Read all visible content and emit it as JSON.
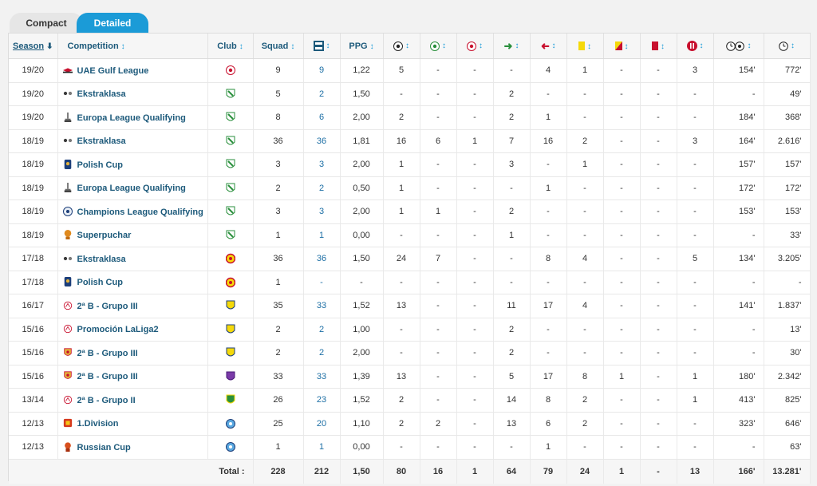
{
  "tabs": [
    {
      "label": "Compact",
      "active": false
    },
    {
      "label": "Detailed",
      "active": true
    }
  ],
  "headers": {
    "season": "Season",
    "competition": "Competition",
    "club": "Club",
    "squad": "Squad",
    "ppg": "PPG"
  },
  "header_icons": [
    "appearances-icon",
    "goals-icon",
    "assists-icon",
    "own-goals-icon",
    "substituted-on-icon",
    "substituted-off-icon",
    "yellow-card-icon",
    "second-yellow-card-icon",
    "red-card-icon",
    "penalty-goals-icon",
    "minutes-per-goal-icon",
    "minutes-played-icon"
  ],
  "rows": [
    {
      "season": "19/20",
      "competition": "UAE Gulf League",
      "comp_icon": "gulf-league-icon",
      "club_icon": "club-crest-icon",
      "squad": "9",
      "apps": "9",
      "ppg": "1,22",
      "goals": "5",
      "assists": "-",
      "own_goals": "-",
      "sub_on": "-",
      "sub_off": "4",
      "yellow": "1",
      "second_yellow": "-",
      "red": "-",
      "penalty": "3",
      "min_per_goal": "154'",
      "minutes": "772'"
    },
    {
      "season": "19/20",
      "competition": "Ekstraklasa",
      "comp_icon": "ekstraklasa-icon",
      "club_icon": "legia-crest-icon",
      "squad": "5",
      "apps": "2",
      "ppg": "1,50",
      "goals": "-",
      "assists": "-",
      "own_goals": "-",
      "sub_on": "2",
      "sub_off": "-",
      "yellow": "-",
      "second_yellow": "-",
      "red": "-",
      "penalty": "-",
      "min_per_goal": "-",
      "minutes": "49'"
    },
    {
      "season": "19/20",
      "competition": "Europa League Qualifying",
      "comp_icon": "europa-league-icon",
      "club_icon": "legia-crest-icon",
      "squad": "8",
      "apps": "6",
      "ppg": "2,00",
      "goals": "2",
      "assists": "-",
      "own_goals": "-",
      "sub_on": "2",
      "sub_off": "1",
      "yellow": "-",
      "second_yellow": "-",
      "red": "-",
      "penalty": "-",
      "min_per_goal": "184'",
      "minutes": "368'"
    },
    {
      "season": "18/19",
      "competition": "Ekstraklasa",
      "comp_icon": "ekstraklasa-icon",
      "club_icon": "legia-crest-icon",
      "squad": "36",
      "apps": "36",
      "ppg": "1,81",
      "goals": "16",
      "assists": "6",
      "own_goals": "1",
      "sub_on": "7",
      "sub_off": "16",
      "yellow": "2",
      "second_yellow": "-",
      "red": "-",
      "penalty": "3",
      "min_per_goal": "164'",
      "minutes": "2.616'"
    },
    {
      "season": "18/19",
      "competition": "Polish Cup",
      "comp_icon": "polish-cup-icon",
      "club_icon": "legia-crest-icon",
      "squad": "3",
      "apps": "3",
      "ppg": "2,00",
      "goals": "1",
      "assists": "-",
      "own_goals": "-",
      "sub_on": "3",
      "sub_off": "-",
      "yellow": "1",
      "second_yellow": "-",
      "red": "-",
      "penalty": "-",
      "min_per_goal": "157'",
      "minutes": "157'"
    },
    {
      "season": "18/19",
      "competition": "Europa League Qualifying",
      "comp_icon": "europa-league-icon",
      "club_icon": "legia-crest-icon",
      "squad": "2",
      "apps": "2",
      "ppg": "0,50",
      "goals": "1",
      "assists": "-",
      "own_goals": "-",
      "sub_on": "-",
      "sub_off": "1",
      "yellow": "-",
      "second_yellow": "-",
      "red": "-",
      "penalty": "-",
      "min_per_goal": "172'",
      "minutes": "172'"
    },
    {
      "season": "18/19",
      "competition": "Champions League Qualifying",
      "comp_icon": "champions-league-icon",
      "club_icon": "legia-crest-icon",
      "squad": "3",
      "apps": "3",
      "ppg": "2,00",
      "goals": "1",
      "assists": "1",
      "own_goals": "-",
      "sub_on": "2",
      "sub_off": "-",
      "yellow": "-",
      "second_yellow": "-",
      "red": "-",
      "penalty": "-",
      "min_per_goal": "153'",
      "minutes": "153'"
    },
    {
      "season": "18/19",
      "competition": "Superpuchar",
      "comp_icon": "superpuchar-icon",
      "club_icon": "legia-crest-icon",
      "squad": "1",
      "apps": "1",
      "ppg": "0,00",
      "goals": "-",
      "assists": "-",
      "own_goals": "-",
      "sub_on": "1",
      "sub_off": "-",
      "yellow": "-",
      "second_yellow": "-",
      "red": "-",
      "penalty": "-",
      "min_per_goal": "-",
      "minutes": "33'"
    },
    {
      "season": "17/18",
      "competition": "Ekstraklasa",
      "comp_icon": "ekstraklasa-icon",
      "club_icon": "jagiellonia-crest-icon",
      "squad": "36",
      "apps": "36",
      "ppg": "1,50",
      "goals": "24",
      "assists": "7",
      "own_goals": "-",
      "sub_on": "-",
      "sub_off": "8",
      "yellow": "4",
      "second_yellow": "-",
      "red": "-",
      "penalty": "5",
      "min_per_goal": "134'",
      "minutes": "3.205'"
    },
    {
      "season": "17/18",
      "competition": "Polish Cup",
      "comp_icon": "polish-cup-icon",
      "club_icon": "jagiellonia-crest-icon",
      "squad": "1",
      "apps": "-",
      "ppg": "-",
      "goals": "-",
      "assists": "-",
      "own_goals": "-",
      "sub_on": "-",
      "sub_off": "-",
      "yellow": "-",
      "second_yellow": "-",
      "red": "-",
      "penalty": "-",
      "min_per_goal": "-",
      "minutes": "-"
    },
    {
      "season": "16/17",
      "competition": "2ª B - Grupo III",
      "comp_icon": "segunda-b-icon",
      "club_icon": "villarreal-crest-icon",
      "squad": "35",
      "apps": "33",
      "ppg": "1,52",
      "goals": "13",
      "assists": "-",
      "own_goals": "-",
      "sub_on": "11",
      "sub_off": "17",
      "yellow": "4",
      "second_yellow": "-",
      "red": "-",
      "penalty": "-",
      "min_per_goal": "141'",
      "minutes": "1.837'"
    },
    {
      "season": "15/16",
      "competition": "Promoción LaLiga2",
      "comp_icon": "segunda-b-icon",
      "club_icon": "villarreal-crest-icon",
      "squad": "2",
      "apps": "2",
      "ppg": "1,00",
      "goals": "-",
      "assists": "-",
      "own_goals": "-",
      "sub_on": "2",
      "sub_off": "-",
      "yellow": "-",
      "second_yellow": "-",
      "red": "-",
      "penalty": "-",
      "min_per_goal": "-",
      "minutes": "13'"
    },
    {
      "season": "15/16",
      "competition": "2ª B - Grupo III",
      "comp_icon": "rfef-icon",
      "club_icon": "villarreal-crest-icon",
      "squad": "2",
      "apps": "2",
      "ppg": "2,00",
      "goals": "-",
      "assists": "-",
      "own_goals": "-",
      "sub_on": "2",
      "sub_off": "-",
      "yellow": "-",
      "second_yellow": "-",
      "red": "-",
      "penalty": "-",
      "min_per_goal": "-",
      "minutes": "30'"
    },
    {
      "season": "15/16",
      "competition": "2ª B - Grupo III",
      "comp_icon": "rfef-icon",
      "club_icon": "eldense-crest-icon",
      "squad": "33",
      "apps": "33",
      "ppg": "1,39",
      "goals": "13",
      "assists": "-",
      "own_goals": "-",
      "sub_on": "5",
      "sub_off": "17",
      "yellow": "8",
      "second_yellow": "1",
      "red": "-",
      "penalty": "1",
      "min_per_goal": "180'",
      "minutes": "2.342'"
    },
    {
      "season": "13/14",
      "competition": "2ª B - Grupo II",
      "comp_icon": "segunda-b-icon",
      "club_icon": "club-crest-green-icon",
      "squad": "26",
      "apps": "23",
      "ppg": "1,52",
      "goals": "2",
      "assists": "-",
      "own_goals": "-",
      "sub_on": "14",
      "sub_off": "8",
      "yellow": "2",
      "second_yellow": "-",
      "red": "-",
      "penalty": "1",
      "min_per_goal": "413'",
      "minutes": "825'"
    },
    {
      "season": "12/13",
      "competition": "1.Division",
      "comp_icon": "first-division-icon",
      "club_icon": "club-crest-blue-icon",
      "squad": "25",
      "apps": "20",
      "ppg": "1,10",
      "goals": "2",
      "assists": "2",
      "own_goals": "-",
      "sub_on": "13",
      "sub_off": "6",
      "yellow": "2",
      "second_yellow": "-",
      "red": "-",
      "penalty": "-",
      "min_per_goal": "323'",
      "minutes": "646'"
    },
    {
      "season": "12/13",
      "competition": "Russian Cup",
      "comp_icon": "russian-cup-icon",
      "club_icon": "club-crest-blue-icon",
      "squad": "1",
      "apps": "1",
      "ppg": "0,00",
      "goals": "-",
      "assists": "-",
      "own_goals": "-",
      "sub_on": "-",
      "sub_off": "1",
      "yellow": "-",
      "second_yellow": "-",
      "red": "-",
      "penalty": "-",
      "min_per_goal": "-",
      "minutes": "63'"
    }
  ],
  "total": {
    "label": "Total :",
    "squad": "228",
    "apps": "212",
    "ppg": "1,50",
    "goals": "80",
    "assists": "16",
    "own_goals": "1",
    "sub_on": "64",
    "sub_off": "79",
    "yellow": "24",
    "second_yellow": "1",
    "red": "-",
    "penalty": "13",
    "min_per_goal": "166'",
    "minutes": "13.281'"
  },
  "colors": {
    "accent": "#1b9bd7",
    "link": "#1d5a7b",
    "red": "#c8102e",
    "yellow": "#f5d90a",
    "green": "#2a8f3c"
  }
}
